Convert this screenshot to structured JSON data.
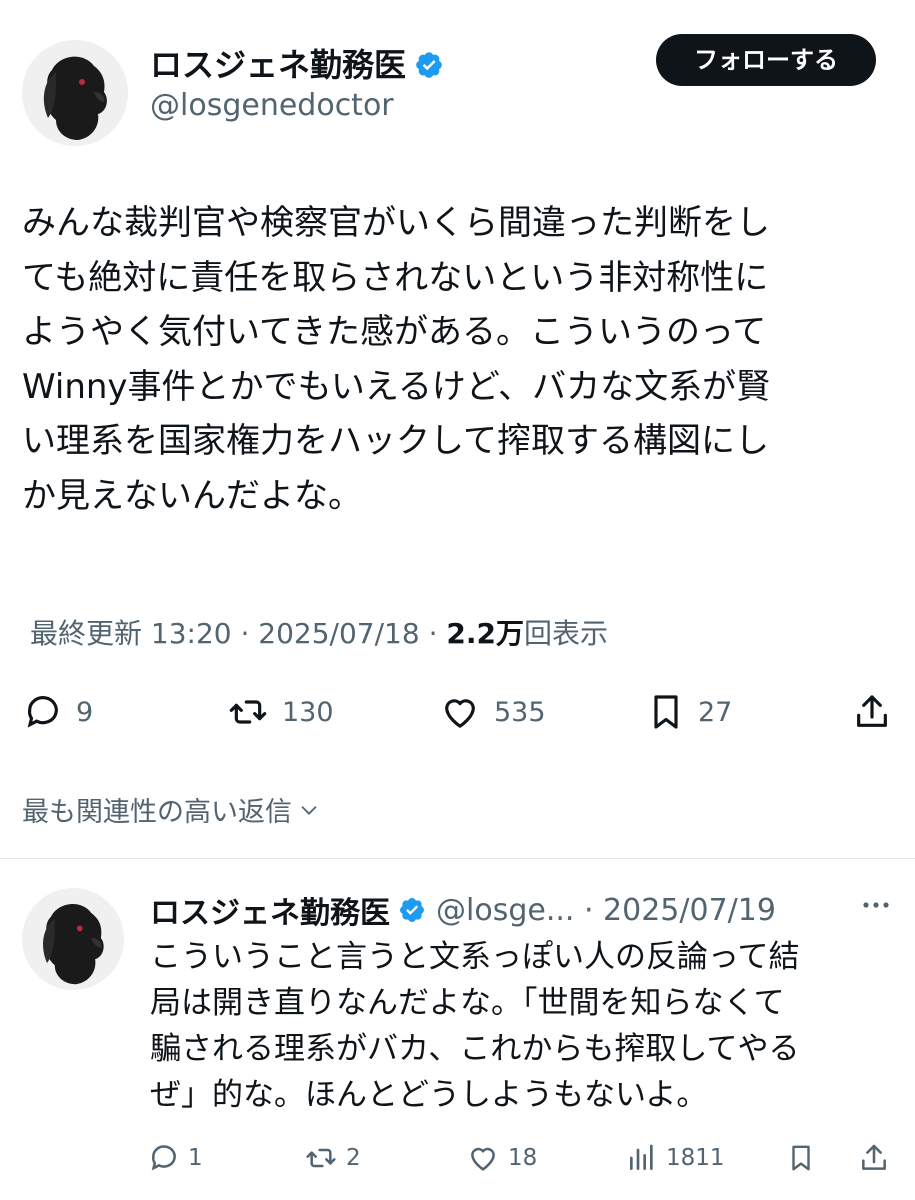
{
  "colors": {
    "text": "#0f1419",
    "secondary": "#536471",
    "verified_blue": "#1d9bf0",
    "follow_bg": "#0f1419",
    "divider": "#e1e6ea"
  },
  "main_post": {
    "author_name": "ロスジェネ勤務医",
    "handle": "@losgenedoctor",
    "verified_icon": "verified-badge-icon",
    "follow_label": "フォローする",
    "text": "みんな裁判官や検察官がいくら間違った判断をし\nても絶対に責任を取らされないという非対称性に\nようやく気付いてきた感がある。こういうのって\nWinny事件とかでもいえるけど、バカな文系が賢\nい理系を国家権力をハックして搾取する構図にし\nか見えないんだよな。",
    "meta_prefix": "最終更新 13:20 · 2025/07/18 · ",
    "views_count": "2.2万",
    "views_label": "回表示",
    "actions": {
      "replies": "9",
      "reposts": "130",
      "likes": "535",
      "bookmarks": "27"
    }
  },
  "replies_section": {
    "sort_label": "最も関連性の高い返信"
  },
  "reply": {
    "author_name": "ロスジェネ勤務医",
    "handle_date": "@losge... · 2025/07/19",
    "text": "こういうこと言うと文系っぽい人の反論って結\n局は開き直りなんだよな。「世間を知らなくて\n騙される理系がバカ、これからも搾取してやる\nぜ」的な。ほんとどうしようもないよ。",
    "actions": {
      "replies": "1",
      "reposts": "2",
      "likes": "18",
      "views": "1811"
    }
  }
}
